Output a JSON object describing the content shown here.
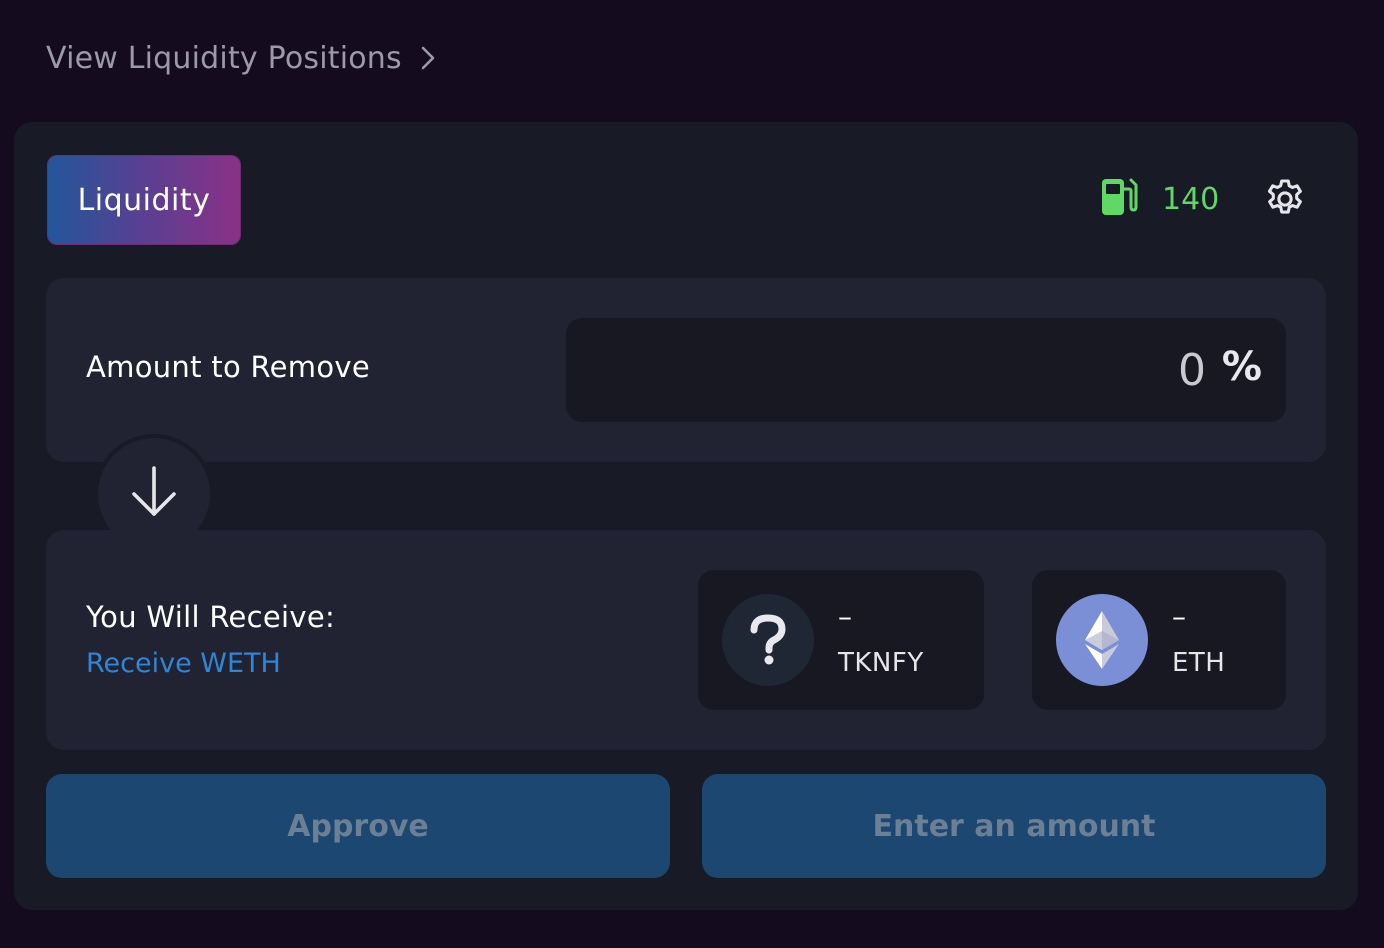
{
  "breadcrumb": {
    "label": "View Liquidity Positions",
    "icon": "chevron-right-icon"
  },
  "header": {
    "tab_label": "Liquidity",
    "gas_icon": "gas-pump-icon",
    "gas_value": "140",
    "settings_icon": "gear-icon"
  },
  "remove": {
    "label": "Amount to Remove",
    "value": "0",
    "unit": "%"
  },
  "divider": {
    "icon": "arrow-down-icon"
  },
  "receive": {
    "label": "You Will Receive:",
    "link": "Receive WETH",
    "tokens": [
      {
        "amount": "–",
        "symbol": "TKNFY",
        "icon": "unknown-token-icon"
      },
      {
        "amount": "–",
        "symbol": "ETH",
        "icon": "ethereum-icon"
      }
    ]
  },
  "actions": {
    "approve_label": "Approve",
    "submit_label": "Enter an amount"
  },
  "colors": {
    "background": "#140b1f",
    "card": "#181a25",
    "panel": "#212332",
    "input": "#171821",
    "gas_green": "#5fd866",
    "link_blue": "#2f86d6",
    "button": "#1b4771",
    "button_text": "#6b7f95"
  }
}
